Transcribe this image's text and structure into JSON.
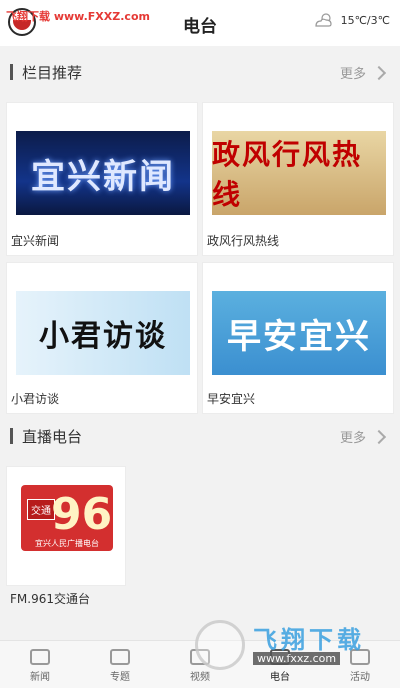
{
  "header": {
    "watermark": "飞翔下载 www.FXXZ.com",
    "title": "电台",
    "weather": "15℃/3℃",
    "weather_icon": "partly-cloudy-icon"
  },
  "featured": {
    "label": "栏目推荐",
    "more": "更多",
    "items": [
      {
        "caption": "宜兴新闻",
        "thumb_text": "宜兴新闻"
      },
      {
        "caption": "政风行风热线",
        "thumb_text": "政风行风热线"
      },
      {
        "caption": "小君访谈",
        "thumb_text": "小君访谈"
      },
      {
        "caption": "早安宜兴",
        "thumb_text": "早安宜兴"
      }
    ]
  },
  "live": {
    "label": "直播电台",
    "more": "更多",
    "station": {
      "caption": "FM.961交通台",
      "logo_badge": "交通",
      "logo_number": "96.1",
      "logo_sub": "宜兴人民广播电台"
    }
  },
  "tabbar": [
    {
      "label": "新闻",
      "icon": "news-icon"
    },
    {
      "label": "专题",
      "icon": "tag-icon"
    },
    {
      "label": "视频",
      "icon": "video-icon"
    },
    {
      "label": "电台",
      "icon": "radio-icon"
    },
    {
      "label": "活动",
      "icon": "activity-icon"
    }
  ],
  "bottom_watermark": {
    "title": "飞翔下载",
    "url": "www.fxxz.com"
  }
}
